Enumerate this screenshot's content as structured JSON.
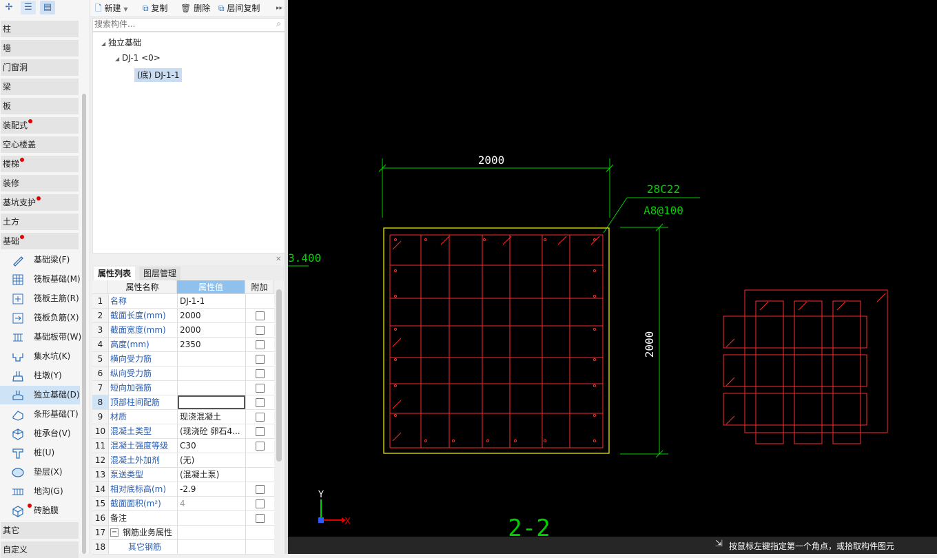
{
  "toolbar_left": {
    "icons": [
      "pin-icon",
      "list-icon",
      "list-detail-icon"
    ]
  },
  "categories": [
    {
      "label": "柱",
      "dot": false
    },
    {
      "label": "墙",
      "dot": false
    },
    {
      "label": "门窗洞",
      "dot": false
    },
    {
      "label": "梁",
      "dot": false
    },
    {
      "label": "板",
      "dot": false
    },
    {
      "label": "装配式",
      "dot": true
    },
    {
      "label": "空心楼盖",
      "dot": false
    },
    {
      "label": "楼梯",
      "dot": true
    },
    {
      "label": "装修",
      "dot": false
    },
    {
      "label": "基坑支护",
      "dot": true
    },
    {
      "label": "土方",
      "dot": false
    },
    {
      "label": "基础",
      "dot": true
    }
  ],
  "foundation_items": [
    {
      "label": "基础梁(F)",
      "icon": "beam-icon"
    },
    {
      "label": "筏板基础(M)",
      "icon": "raft-icon"
    },
    {
      "label": "筏板主筋(R)",
      "icon": "raft-main-rebar-icon"
    },
    {
      "label": "筏板负筋(X)",
      "icon": "raft-neg-rebar-icon"
    },
    {
      "label": "基础板带(W)",
      "icon": "strip-band-icon"
    },
    {
      "label": "集水坑(K)",
      "icon": "sump-icon"
    },
    {
      "label": "柱墩(Y)",
      "icon": "column-pier-icon"
    },
    {
      "label": "独立基础(D)",
      "icon": "isolated-footing-icon",
      "selected": true
    },
    {
      "label": "条形基础(T)",
      "icon": "strip-footing-icon"
    },
    {
      "label": "桩承台(V)",
      "icon": "pile-cap-icon"
    },
    {
      "label": "桩(U)",
      "icon": "pile-icon"
    },
    {
      "label": "垫层(X)",
      "icon": "cushion-icon"
    },
    {
      "label": "地沟(G)",
      "icon": "trench-icon"
    },
    {
      "label": "砖胎膜",
      "icon": "brick-form-icon",
      "dot": true
    }
  ],
  "bottom_categories": [
    {
      "label": "其它"
    },
    {
      "label": "自定义"
    }
  ],
  "mid_toolbar": {
    "new": "新建",
    "copy": "复制",
    "delete": "删除",
    "floor_copy": "层间复制"
  },
  "search": {
    "placeholder": "搜索构件..."
  },
  "tree": {
    "root": "独立基础",
    "child": "DJ-1 <0>",
    "leaf": "(底) DJ-1-1"
  },
  "tabs": {
    "props": "属性列表",
    "layers": "图层管理"
  },
  "grid": {
    "headers": {
      "name": "属性名称",
      "value": "属性值",
      "extra": "附加"
    },
    "rows": [
      {
        "n": "1",
        "k": "名称",
        "v": "DJ-1-1",
        "cb": false
      },
      {
        "n": "2",
        "k": "截面长度(mm)",
        "v": "2000",
        "cb": true
      },
      {
        "n": "3",
        "k": "截面宽度(mm)",
        "v": "2000",
        "cb": true
      },
      {
        "n": "4",
        "k": "高度(mm)",
        "v": "2350",
        "cb": true
      },
      {
        "n": "5",
        "k": "横向受力筋",
        "v": "",
        "cb": true
      },
      {
        "n": "6",
        "k": "纵向受力筋",
        "v": "",
        "cb": true
      },
      {
        "n": "7",
        "k": "短向加强筋",
        "v": "",
        "cb": true
      },
      {
        "n": "8",
        "k": "顶部柱间配筋",
        "v": "",
        "cb": true,
        "sel": true
      },
      {
        "n": "9",
        "k": "材质",
        "v": "现浇混凝土",
        "cb": true
      },
      {
        "n": "10",
        "k": "混凝土类型",
        "v": "(现浇砼 卵石4...",
        "cb": true
      },
      {
        "n": "11",
        "k": "混凝土强度等级",
        "v": "C30",
        "cb": true
      },
      {
        "n": "12",
        "k": "混凝土外加剂",
        "v": "(无)",
        "cb": false
      },
      {
        "n": "13",
        "k": "泵送类型",
        "v": "(混凝土泵)",
        "cb": false
      },
      {
        "n": "14",
        "k": "相对底标高(m)",
        "v": "-2.9",
        "cb": true
      },
      {
        "n": "15",
        "k": "截面面积(m²)",
        "v": "4",
        "cb": true
      },
      {
        "n": "16",
        "k": "备注",
        "v": "",
        "cb": true
      },
      {
        "n": "17",
        "k": "钢筋业务属性",
        "v": "",
        "cb": false
      },
      {
        "n": "18",
        "k": "其它钢筋",
        "v": "",
        "cb": false
      }
    ]
  },
  "cad": {
    "dim_top": "2000",
    "dim_right": "2000",
    "rebar_label_1": "28C22",
    "rebar_label_2": "A8@100",
    "elev_label": "3.400",
    "section_label": "2-2",
    "axis_y": "Y",
    "axis_x": "X",
    "status_text": "按鼠标左键指定第一个角点，或拾取构件图元",
    "colors": {
      "bg": "#000000",
      "rebar": "#ff2a2a",
      "outline": "#e6e600",
      "dim": "#00d000"
    }
  }
}
